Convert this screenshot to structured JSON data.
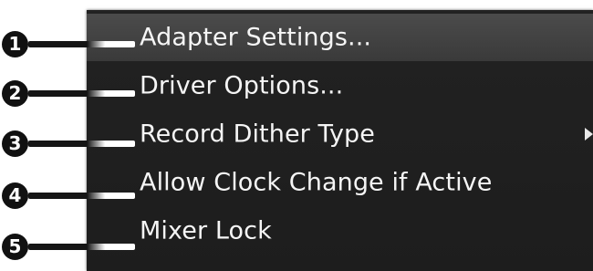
{
  "menu": {
    "items": [
      {
        "label": "Adapter Settings...",
        "highlighted": true,
        "has_submenu": false
      },
      {
        "label": "Driver Options...",
        "highlighted": false,
        "has_submenu": false
      },
      {
        "label": "Record Dither Type",
        "highlighted": false,
        "has_submenu": true
      },
      {
        "label": "Allow Clock Change if Active",
        "highlighted": false,
        "has_submenu": false
      },
      {
        "label": "Mixer Lock",
        "highlighted": false,
        "has_submenu": false
      }
    ]
  },
  "callouts": [
    "1",
    "2",
    "3",
    "4",
    "5"
  ],
  "colors": {
    "menu_background": "#1f1f1f",
    "highlight_background": "#444444",
    "menu_text": "#f5f5f5",
    "callout_badge": "#111111"
  }
}
